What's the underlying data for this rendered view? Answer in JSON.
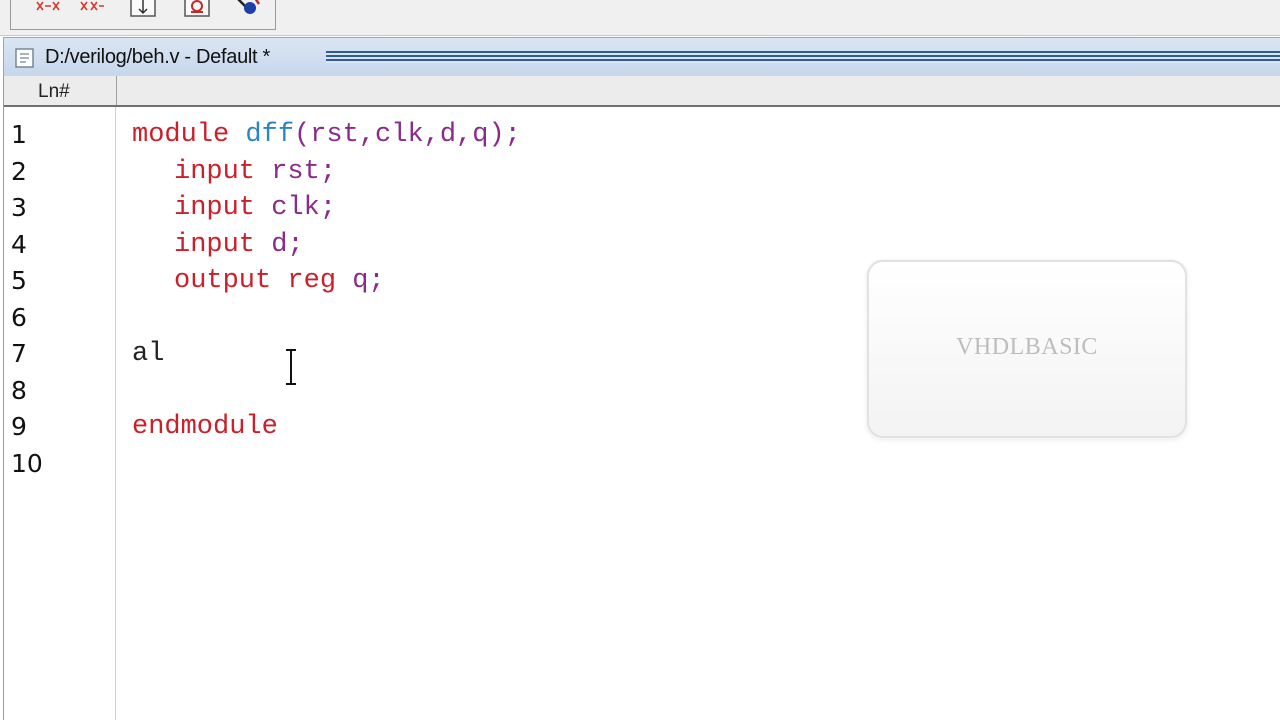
{
  "window": {
    "title": "D:/verilog/beh.v - Default *"
  },
  "toolbar": {
    "buttons": [
      {
        "icon": "wave-compare-icon"
      },
      {
        "icon": "wave-compare-alt-icon"
      },
      {
        "icon": "column-icon"
      },
      {
        "icon": "break-icon"
      },
      {
        "icon": "run-marker-icon"
      }
    ]
  },
  "editor": {
    "gutter_header": "Ln#",
    "line_numbers": [
      "1",
      "2",
      "3",
      "4",
      "5",
      "6",
      "7",
      "8",
      "9",
      "10"
    ],
    "lines": [
      [
        {
          "t": "module",
          "c": "kw"
        },
        {
          "t": " ",
          "c": "tx"
        },
        {
          "t": "dff",
          "c": "fn"
        },
        {
          "t": "(rst,clk,d,q);",
          "c": "id"
        }
      ],
      [
        {
          "t": "input",
          "c": "kw"
        },
        {
          "t": " ",
          "c": "tx"
        },
        {
          "t": "rst;",
          "c": "id"
        }
      ],
      [
        {
          "t": "input",
          "c": "kw"
        },
        {
          "t": " ",
          "c": "tx"
        },
        {
          "t": "clk;",
          "c": "id"
        }
      ],
      [
        {
          "t": "input",
          "c": "kw"
        },
        {
          "t": " ",
          "c": "tx"
        },
        {
          "t": "d;",
          "c": "id"
        }
      ],
      [
        {
          "t": "output",
          "c": "kw"
        },
        {
          "t": " ",
          "c": "tx"
        },
        {
          "t": "reg",
          "c": "kw"
        },
        {
          "t": " ",
          "c": "tx"
        },
        {
          "t": "q;",
          "c": "id"
        }
      ],
      [],
      [
        {
          "t": "al",
          "c": "tx"
        }
      ],
      [],
      [
        {
          "t": "endmodule",
          "c": "kw"
        }
      ],
      []
    ],
    "indented_lines": [
      1,
      2,
      3,
      4
    ]
  },
  "overlay": {
    "text": "VHDLBASIC"
  },
  "colors": {
    "keyword": "#cc1f2a",
    "identifier": "#8a2a8a",
    "function": "#2b86c4",
    "text": "#222222"
  }
}
